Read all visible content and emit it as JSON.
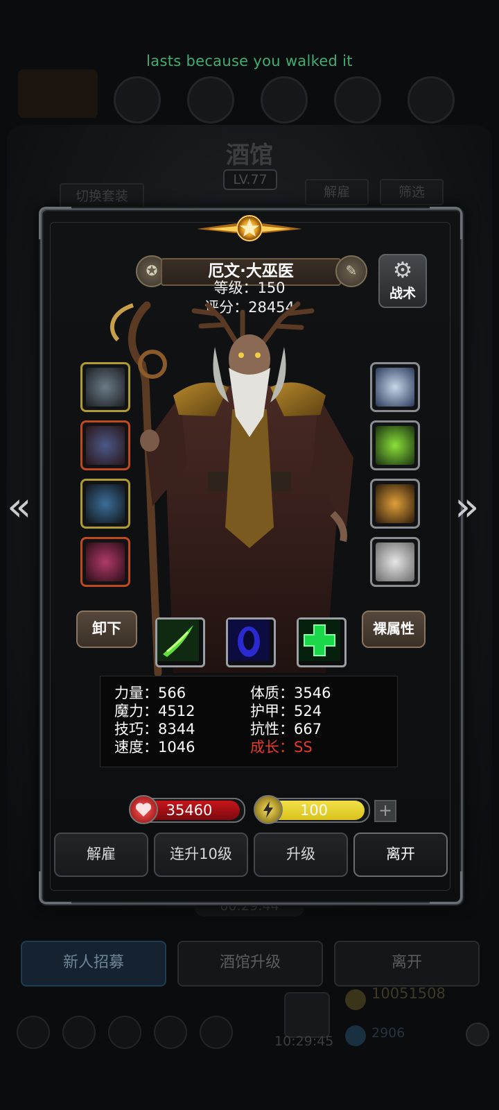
{
  "toast": "lasts because you walked it",
  "background": {
    "title": "酒馆",
    "level": "LV.77",
    "switch_outfit": "切换套装",
    "dismiss": "解雇",
    "filter": "筛选",
    "timer": "00:29:44",
    "recruit": "新人招募",
    "tavern_upgrade": "酒馆升级",
    "leave": "离开",
    "gold": "10051508",
    "gems": "2906",
    "gift_timer": "10:29:45"
  },
  "hero": {
    "name": "厄文·大巫医",
    "level_line": "等级：150",
    "score_line": "评分：28454",
    "tactics_label": "战术"
  },
  "buttons": {
    "unequip": "卸下",
    "base_attrs": "裸属性"
  },
  "stats": {
    "strength": "力量：566",
    "magic": "魔力：4512",
    "skill": "技巧：8344",
    "speed": "速度：1046",
    "constitution": "体质：3546",
    "armor": "护甲：524",
    "resistance": "抗性：667",
    "growth": "成长：SS"
  },
  "bars": {
    "hp": "35460",
    "energy": "100",
    "hp_fill": 1.0,
    "energy_fill": 1.0,
    "hp_color": "#c8151b",
    "energy_color": "#d9c21a"
  },
  "actions": {
    "dismiss": "解雇",
    "level10": "连升10级",
    "upgrade": "升级",
    "leave": "离开"
  },
  "icons": {
    "prev": "chevron-left-icon",
    "next": "chevron-right-icon",
    "tactics": "gear-icon"
  }
}
